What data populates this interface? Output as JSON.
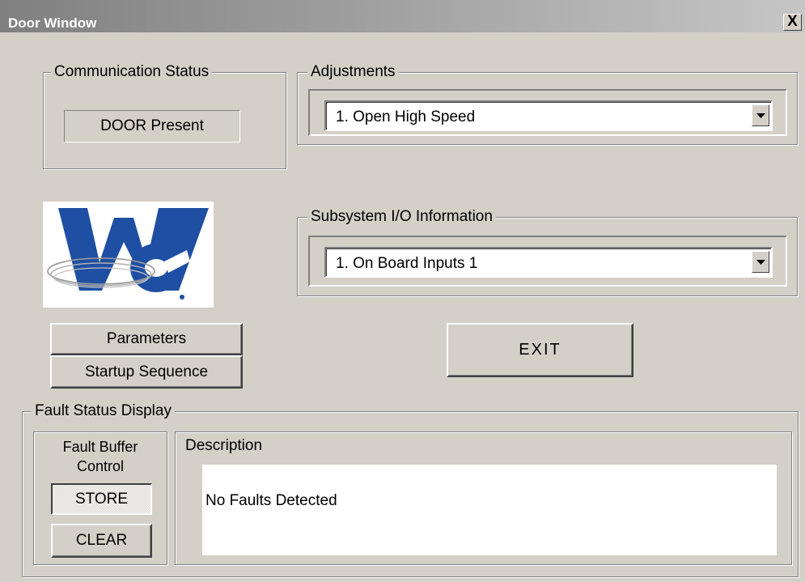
{
  "window": {
    "title": "Door Window",
    "close_symbol": "X"
  },
  "communication": {
    "label": "Communication Status",
    "status": "DOOR Present"
  },
  "adjustments": {
    "label": "Adjustments",
    "selected": "1. Open High Speed"
  },
  "subsystem": {
    "label": "Subsystem I/O Information",
    "selected": "1. On Board Inputs 1"
  },
  "logo": {
    "icon": "ve-logo",
    "brand_color": "#1f4fa3"
  },
  "buttons": {
    "parameters": "Parameters",
    "startup": "Startup Sequence",
    "exit": "EXIT"
  },
  "fault": {
    "label": "Fault Status Display",
    "buffer_label_line1": "Fault Buffer",
    "buffer_label_line2": "Control",
    "store": "STORE",
    "clear": "CLEAR",
    "description_label": "Description",
    "description_text": "No Faults Detected"
  }
}
